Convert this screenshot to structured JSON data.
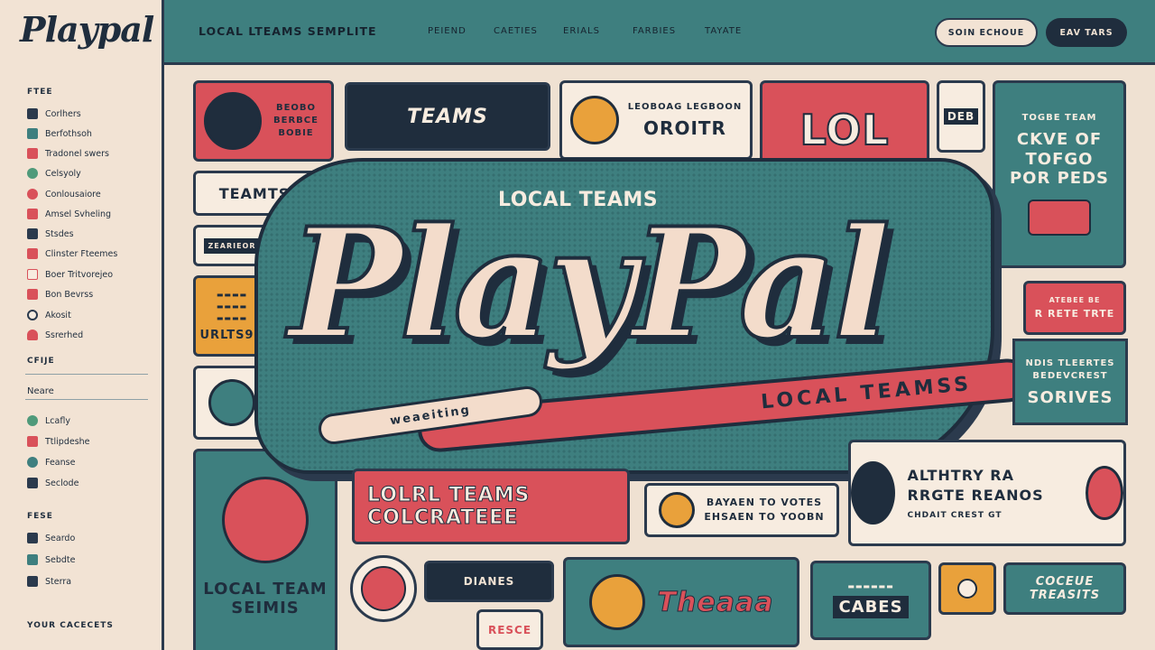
{
  "app": {
    "logo": "Playpal"
  },
  "topbar": {
    "title": "LOCAL LTEAMS SEMPLITE",
    "nav": [
      "PEIEND",
      "CAETIES",
      "ERIALS",
      "FARBIES",
      "TAYATE"
    ],
    "button_outline": "SOIN ECHOUE",
    "button_dark": "EAV TARS"
  },
  "sidebar": {
    "section1_title": "FTEE",
    "items1": [
      {
        "label": "Corlhers",
        "icon": "grid-icon",
        "color": "#2b3a4d"
      },
      {
        "label": "Berfothsoh",
        "icon": "square-icon",
        "color": "#3e7f7f"
      },
      {
        "label": "Tradonel swers",
        "icon": "pen-icon",
        "color": "#d9515a"
      },
      {
        "label": "Celsyoly",
        "icon": "leaf-icon",
        "color": "#4f9a7a"
      },
      {
        "label": "Conlousaiore",
        "icon": "circle-icon",
        "color": "#d9515a"
      },
      {
        "label": "Amsel Svheling",
        "icon": "arrow-icon",
        "color": "#d9515a"
      },
      {
        "label": "Stsdes",
        "icon": "grid-icon",
        "color": "#2b3a4d"
      },
      {
        "label": "Clinster Fteemes",
        "icon": "tag-icon",
        "color": "#d9515a"
      },
      {
        "label": "Boer Tritvorejeo",
        "icon": "page-icon",
        "color": "#d9515a"
      },
      {
        "label": "Bon Bevrss",
        "icon": "heart-icon",
        "color": "#d9515a"
      },
      {
        "label": "Akosit",
        "icon": "clock-icon",
        "color": "#2b3a4d"
      },
      {
        "label": "Ssrerhed",
        "icon": "pin-icon",
        "color": "#d9515a"
      }
    ],
    "section2_title": "CFIJE",
    "name_label": "Neare",
    "items2": [
      {
        "label": "Lcafly",
        "icon": "ball-icon",
        "color": "#4f9a7a"
      },
      {
        "label": "Ttlipdeshe",
        "icon": "shield-icon",
        "color": "#d9515a"
      },
      {
        "label": "Feanse",
        "icon": "globe-icon",
        "color": "#3e7f7f"
      },
      {
        "label": "Seclode",
        "icon": "stack-icon",
        "color": "#2b3a4d"
      }
    ],
    "section3_title": "FESE",
    "items3": [
      {
        "label": "Seardo",
        "icon": "link-icon",
        "color": "#2b3a4d"
      },
      {
        "label": "Sebdte",
        "icon": "brush-icon",
        "color": "#3e7f7f"
      },
      {
        "label": "Sterra",
        "icon": "play-icon",
        "color": "#2b3a4d"
      }
    ],
    "footer": "YOUR CACECETS"
  },
  "hero": {
    "kicker": "LOCAL TEAMS",
    "title": "PlayPal",
    "ribbon": "LOCAL TEAMSS",
    "tail": "weaeiting"
  },
  "tiles": {
    "t1": "BEOBO BERBCE BOBIE",
    "t2": "TEAMS",
    "t3_top": "LEOBOAG LEGBOON",
    "t3_main": "OROITR",
    "t4": "LOL",
    "t5": "DEB",
    "t6_top": "TOGBE TEAM",
    "t6_main": "CKVE OF TOFGO POR PEDS",
    "t7": "TEAMTS",
    "t8": "ZEARIEOR",
    "t9": "URLTS9R",
    "t10_top": "ATEBEE BE",
    "t10_main": "R RETE TRTE",
    "t11": "NDIS TLEERTES BEDEVCREST",
    "t11_main": "SORIVES",
    "t12_a": "LOLRL TEAMS",
    "t12_b": "COLCRATEEE",
    "t13_a": "BAYAEN TO VOTES",
    "t13_b": "EHSAEN TO YOOBN",
    "t14": "ALTHTRY RA RRGTE REANOS",
    "t14_sub": "CHDAIT CREST GT",
    "t15_top": "LOCAL TEAM",
    "t15_main": "SEIMIS",
    "t16": "DIANES",
    "t17": "Theaaa",
    "t18": "CABES",
    "t19": "COCEUE TREASITS",
    "t20": "RESCE"
  }
}
